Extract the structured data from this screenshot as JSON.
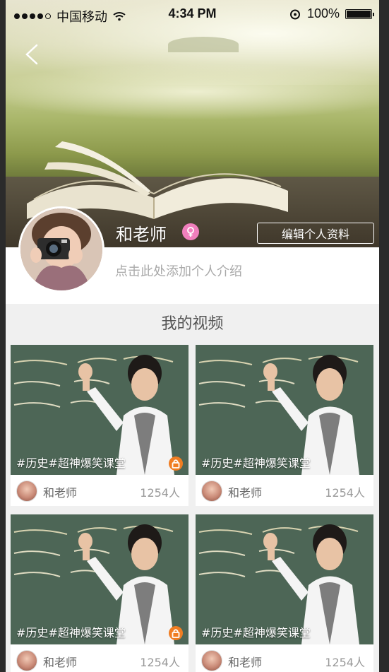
{
  "status_bar": {
    "carrier": "中国移动",
    "time": "4:34 PM",
    "battery": "100%"
  },
  "profile": {
    "name": "和老师",
    "edit_label": "编辑个人资料",
    "bio_placeholder": "点击此处添加个人介绍",
    "gender": "female"
  },
  "videos_section": {
    "title": "我的视频",
    "items": [
      {
        "tag": "#历史#超神爆笑课堂",
        "author": "和老师",
        "count": "1254人",
        "locked": true
      },
      {
        "tag": "#历史#超神爆笑课堂",
        "author": "和老师",
        "count": "1254人",
        "locked": false
      },
      {
        "tag": "#历史#超神爆笑课堂",
        "author": "和老师",
        "count": "1254人",
        "locked": true
      },
      {
        "tag": "#历史#超神爆笑课堂",
        "author": "和老师",
        "count": "1254人",
        "locked": false
      }
    ]
  },
  "colors": {
    "accent_lock": "#f07d22",
    "gender_pink": "#f07fbd",
    "background": "#f0f0f0"
  },
  "icons": [
    "back-arrow-icon",
    "wifi-icon",
    "alarm-icon",
    "battery-icon",
    "female-icon",
    "lock-icon"
  ]
}
